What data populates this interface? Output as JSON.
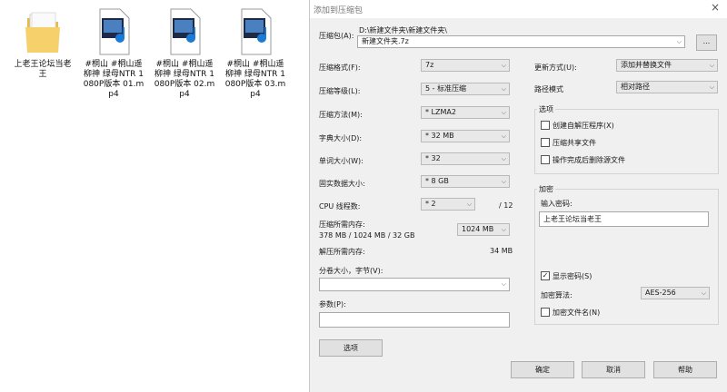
{
  "desktop": {
    "items": [
      {
        "name": "上老王论坛当老王",
        "type": "folder"
      },
      {
        "name": "#桐山 #桐山遥 柳神 绿母NTR 1080P版本 01.mp4",
        "type": "video"
      },
      {
        "name": "#桐山 #桐山遥 柳神 绿母NTR 1080P版本 02.mp4",
        "type": "video"
      },
      {
        "name": "#桐山 #桐山遥 柳神 绿母NTR 1080P版本 03.mp4",
        "type": "video"
      }
    ]
  },
  "dialog": {
    "title": "添加到压缩包",
    "close_icon": "×",
    "archive": {
      "label": "压缩包(A):",
      "path": "D:\\新建文件夹\\新建文件夹\\",
      "value": "新建文件夹.7z",
      "browse_label": "..."
    },
    "format": {
      "label": "压缩格式(F):",
      "value": "7z"
    },
    "level": {
      "label": "压缩等级(L):",
      "value": "5 - 标准压缩"
    },
    "method": {
      "label": "压缩方法(M):",
      "value": "* LZMA2"
    },
    "dict": {
      "label": "字典大小(D):",
      "value": "* 32 MB"
    },
    "word": {
      "label": "单词大小(W):",
      "value": "* 32"
    },
    "solid": {
      "label": "固实数据大小:",
      "value": "* 8 GB"
    },
    "threads": {
      "label": "CPU 线程数:",
      "value": "* 2",
      "max": "/ 12"
    },
    "memory_compress": {
      "label": "压缩所需内存:",
      "detail": "378 MB / 1024 MB / 32 GB",
      "value": "1024 MB"
    },
    "memory_decompress": {
      "label": "解压所需内存:",
      "value": "34 MB"
    },
    "split": {
      "label": "分卷大小，字节(V):",
      "value": ""
    },
    "params": {
      "label": "参数(P):",
      "value": ""
    },
    "options_button": "选项",
    "update": {
      "label": "更新方式(U):",
      "value": "添加并替换文件"
    },
    "pathmode": {
      "label": "路径模式",
      "value": "相对路径"
    },
    "options_group": {
      "title": "选项",
      "sfx": {
        "label": "创建自解压程序(X)",
        "checked": false
      },
      "shared": {
        "label": "压缩共享文件",
        "checked": false
      },
      "delete": {
        "label": "操作完成后删除源文件",
        "checked": false
      }
    },
    "encryption": {
      "title": "加密",
      "password_label": "输入密码:",
      "password_value": "上老王论坛当老王",
      "show_password": {
        "label": "显示密码(S)",
        "checked": true,
        "mark": "✓"
      },
      "method_label": "加密算法:",
      "method_value": "AES-256",
      "encrypt_names": {
        "label": "加密文件名(N)",
        "checked": false
      }
    },
    "buttons": {
      "ok": "确定",
      "cancel": "取消",
      "help": "帮助"
    },
    "dropdown_arrow": "⌵"
  }
}
